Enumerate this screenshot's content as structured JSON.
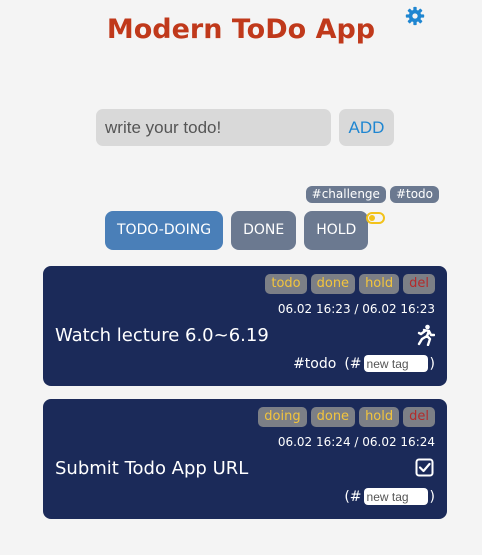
{
  "app": {
    "title": "Modern ToDo App",
    "settings_icon": "gear-icon",
    "accent_color": "#c0391b"
  },
  "input": {
    "placeholder": "write your todo!",
    "value": ""
  },
  "add_button": {
    "label": "ADD"
  },
  "filter_tags": [
    "#challenge",
    "#todo"
  ],
  "tabs": [
    {
      "label": "TODO-DOING",
      "active": true
    },
    {
      "label": "DONE",
      "active": false
    },
    {
      "label": "HOLD",
      "active": false
    }
  ],
  "toggle": {
    "icon": "toggle-icon",
    "state": "on"
  },
  "cards": [
    {
      "title": "Watch lecture 6.0~6.19",
      "time": "06.02 16:23 / 06.02 16:23",
      "actions": [
        "todo",
        "done",
        "hold",
        "del"
      ],
      "status_icon": "running-person-icon",
      "tags": [
        "#todo"
      ],
      "tag_open": "(",
      "tag_hash": "#",
      "tag_placeholder": "new tag",
      "tag_close": ")"
    },
    {
      "title": "Submit Todo App URL",
      "time": "06.02 16:24 / 06.02 16:24",
      "actions": [
        "doing",
        "done",
        "hold",
        "del"
      ],
      "status_icon": "checkbox-checked-icon",
      "tags": [],
      "tag_open": "(",
      "tag_hash": "#",
      "tag_placeholder": "new tag",
      "tag_close": ")"
    }
  ]
}
